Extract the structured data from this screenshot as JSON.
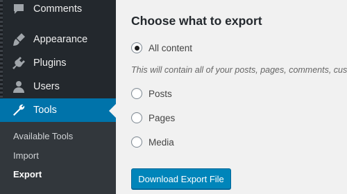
{
  "sidebar": {
    "items": [
      {
        "label": "Comments",
        "icon": "comments-icon"
      },
      {
        "label": "Appearance",
        "icon": "appearance-icon"
      },
      {
        "label": "Plugins",
        "icon": "plugins-icon"
      },
      {
        "label": "Users",
        "icon": "users-icon"
      },
      {
        "label": "Tools",
        "icon": "tools-icon",
        "active": true
      }
    ],
    "submenu": [
      "Available Tools",
      "Import",
      "Export"
    ],
    "current_submenu": "Export"
  },
  "main": {
    "title": "Choose what to export",
    "options": [
      {
        "label": "All content",
        "checked": true
      },
      {
        "label": "Posts",
        "checked": false
      },
      {
        "label": "Pages",
        "checked": false
      },
      {
        "label": "Media",
        "checked": false
      }
    ],
    "description": "This will contain all of your posts, pages, comments, cus",
    "button_label": "Download Export File"
  },
  "colors": {
    "sidebar_bg": "#23282d",
    "submenu_bg": "#32373c",
    "active_bg": "#0073aa",
    "button_bg": "#0085ba",
    "page_bg": "#f1f1f1"
  }
}
